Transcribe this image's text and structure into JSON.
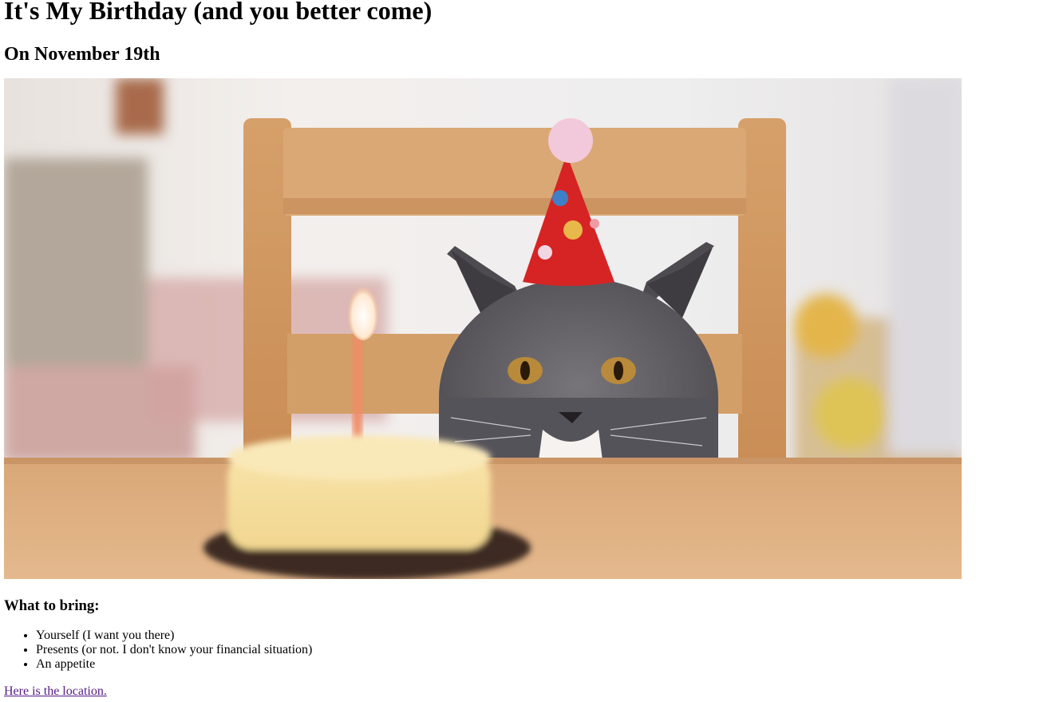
{
  "page": {
    "title": "It's My Birthday (and you better come)",
    "subtitle": "On November 19th"
  },
  "bring": {
    "heading": "What to bring:",
    "items": [
      "Yourself (I want you there)",
      "Presents (or not. I don't know your financial situation)",
      "An appetite"
    ]
  },
  "location_link": "Here is the location.",
  "colors": {
    "link_visited": "#551a8b",
    "text": "#000000",
    "background": "#ffffff"
  }
}
